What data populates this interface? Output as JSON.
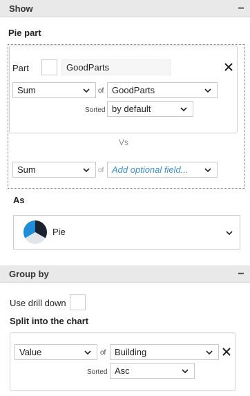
{
  "show": {
    "header": "Show",
    "collapse_symbol": "−",
    "pie_part_title": "Pie part",
    "part_label": "Part",
    "part_value": "GoodParts",
    "agg_value": "Sum",
    "of_label": "of",
    "field_value": "GoodParts",
    "sorted_label": "Sorted",
    "sort_value": "by default",
    "vs_label": "Vs",
    "agg2_value": "Sum",
    "of2_label": "of",
    "field2_placeholder": "Add optional field...",
    "as_label": "As",
    "chart_type_value": "Pie"
  },
  "group_by": {
    "header": "Group by",
    "collapse_symbol": "−",
    "drill_label": "Use drill down",
    "split_title": "Split into the chart",
    "agg_value": "Value",
    "of_label": "of",
    "field_value": "Building",
    "sorted_label": "Sorted",
    "sort_value": "Asc"
  },
  "colors": {
    "header_bg": "#e9e9e9",
    "placeholder_blue": "#3b8fd4",
    "pie_dark": "#1a2230",
    "pie_blue": "#1e8ed8",
    "pie_light": "#e2e6ea"
  }
}
